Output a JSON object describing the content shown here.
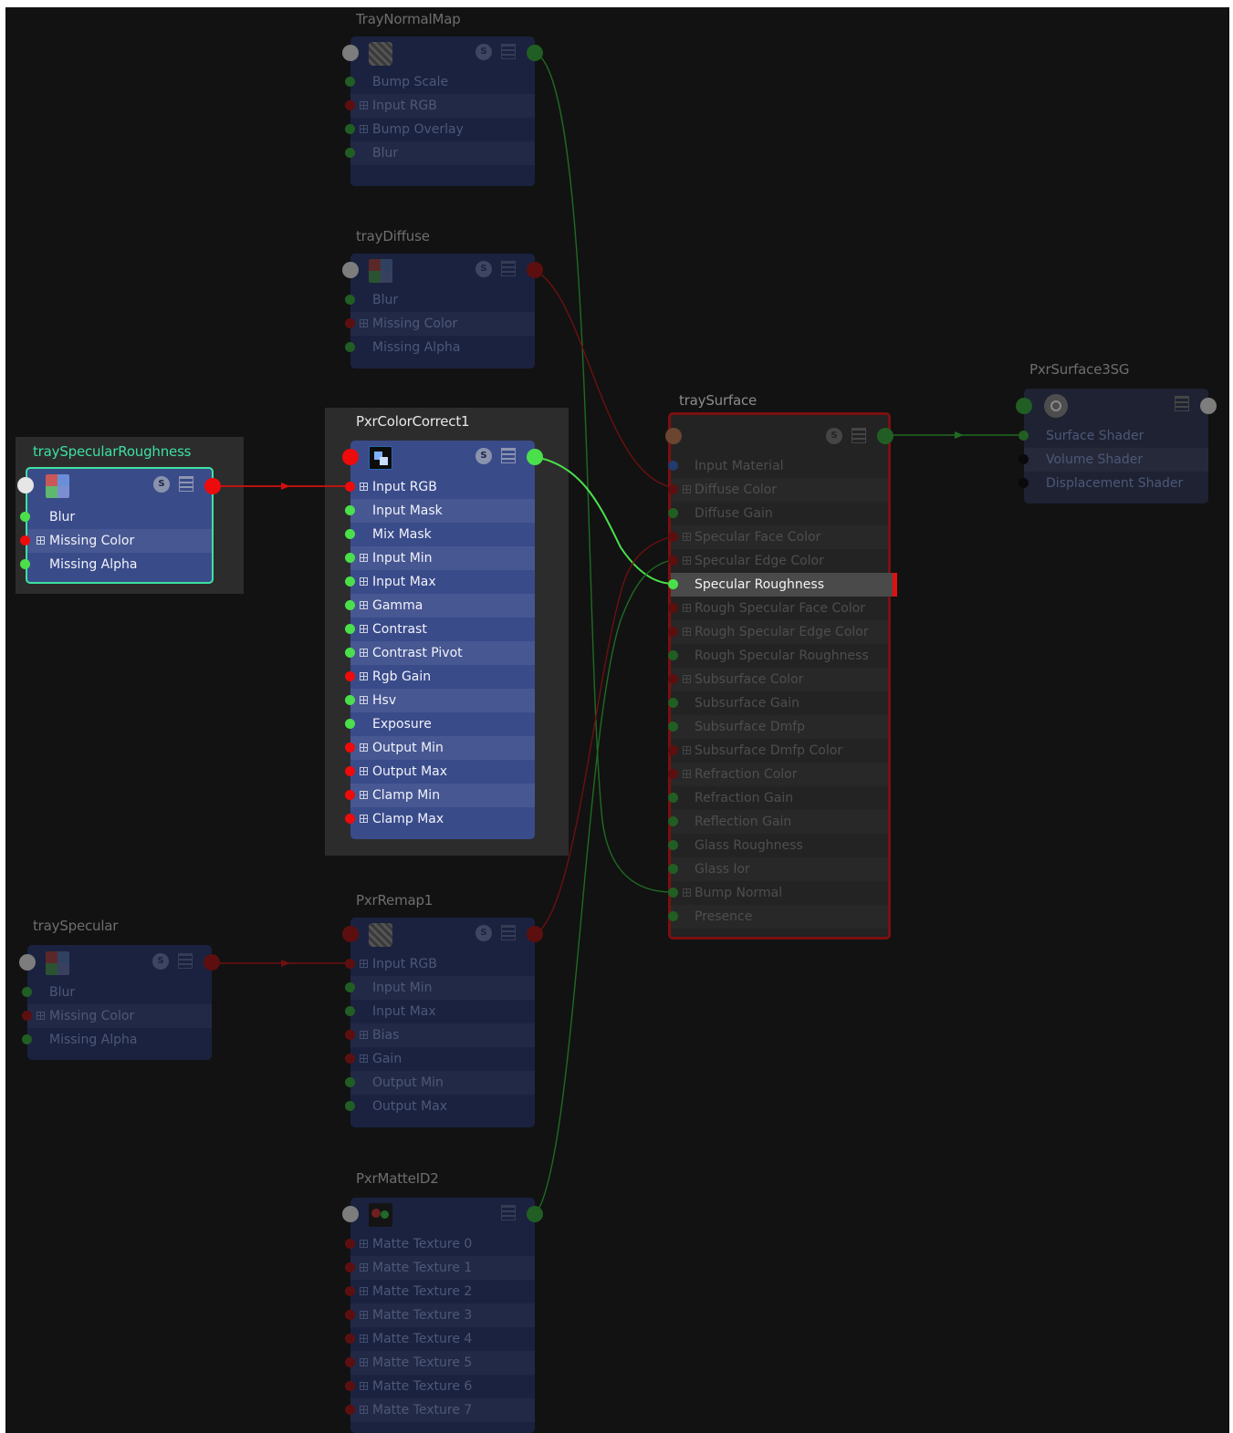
{
  "nodes": {
    "tray_normal_map": {
      "title": "TrayNormalMap",
      "badge": "S",
      "rows": [
        "Bump Scale",
        "Input RGB",
        "Bump Overlay",
        "Blur"
      ]
    },
    "tray_diffuse": {
      "title": "trayDiffuse",
      "badge": "S",
      "rows": [
        "Blur",
        "Missing Color",
        "Missing Alpha"
      ]
    },
    "tray_specular_roughness": {
      "title": "traySpecularRoughness",
      "badge": "S",
      "rows": [
        "Blur",
        "Missing Color",
        "Missing Alpha"
      ]
    },
    "pxr_color_correct": {
      "title": "PxrColorCorrect1",
      "badge": "S",
      "rows": [
        "Input RGB",
        "Input Mask",
        "Mix Mask",
        "Input Min",
        "Input Max",
        "Gamma",
        "Contrast",
        "Contrast Pivot",
        "Rgb Gain",
        "Hsv",
        "Exposure",
        "Output Min",
        "Output Max",
        "Clamp Min",
        "Clamp Max"
      ]
    },
    "tray_specular": {
      "title": "traySpecular",
      "badge": "S",
      "rows": [
        "Blur",
        "Missing Color",
        "Missing Alpha"
      ]
    },
    "pxr_remap": {
      "title": "PxrRemap1",
      "badge": "S",
      "rows": [
        "Input RGB",
        "Input Min",
        "Input Max",
        "Bias",
        "Gain",
        "Output Min",
        "Output Max"
      ]
    },
    "pxr_matte_id": {
      "title": "PxrMatteID2",
      "rows": [
        "Matte Texture 0",
        "Matte Texture 1",
        "Matte Texture 2",
        "Matte Texture 3",
        "Matte Texture 4",
        "Matte Texture 5",
        "Matte Texture 6",
        "Matte Texture 7"
      ]
    },
    "tray_surface": {
      "title": "traySurface",
      "badge": "S",
      "rows": [
        "Input Material",
        "Diffuse Color",
        "Diffuse Gain",
        "Specular Face Color",
        "Specular Edge Color",
        "Specular Roughness",
        "Rough Specular Face Color",
        "Rough Specular Edge Color",
        "Rough Specular Roughness",
        "Subsurface Color",
        "Subsurface Gain",
        "Subsurface Dmfp",
        "Subsurface Dmfp Color",
        "Refraction Color",
        "Refraction Gain",
        "Reflection Gain",
        "Glass Roughness",
        "Glass Ior",
        "Bump Normal",
        "Presence"
      ],
      "highlighted_row": "Specular Roughness"
    },
    "pxr_surface_sg": {
      "title": "PxrSurface3SG",
      "rows": [
        "Surface Shader",
        "Volume Shader",
        "Displacement Shader"
      ]
    }
  },
  "colors": {
    "background": "#121212",
    "node_active": "#3a4b8a",
    "node_dim": "#1a2240",
    "selected_outline": "#3ce2a0",
    "surface_outline": "#7a1010",
    "port_float": "#4be04b",
    "port_color": "#ee0b0b"
  },
  "icons": {
    "texture": "file-texture-icon",
    "color_correct": "color-correct-icon",
    "bump": "bump-map-icon",
    "matte": "matte-id-icon",
    "shading_group": "shading-group-icon"
  }
}
